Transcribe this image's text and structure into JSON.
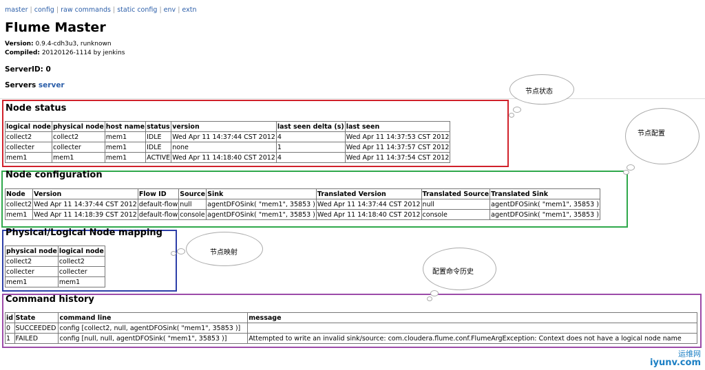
{
  "nav": [
    "master",
    "config",
    "raw commands",
    "static config",
    "env",
    "extn"
  ],
  "title": "Flume Master",
  "version_label": "Version:",
  "version": "0.9.4-cdh3u3, runknown",
  "compiled_label": "Compiled:",
  "compiled": "20120126-1114 by jenkins",
  "serverid_label": "ServerID:",
  "serverid": "0",
  "servers_label": "Servers",
  "servers_link": "server",
  "node_status": {
    "title": "Node status",
    "headers": [
      "logical node",
      "physical node",
      "host name",
      "status",
      "version",
      "last seen delta (s)",
      "last seen"
    ],
    "rows": [
      [
        "collect2",
        "collect2",
        "mem1",
        "IDLE",
        "Wed Apr 11 14:37:44 CST 2012",
        "4",
        "Wed Apr 11 14:37:53 CST 2012"
      ],
      [
        "collecter",
        "collecter",
        "mem1",
        "IDLE",
        "none",
        "1",
        "Wed Apr 11 14:37:57 CST 2012"
      ],
      [
        "mem1",
        "mem1",
        "mem1",
        "ACTIVE",
        "Wed Apr 11 14:18:40 CST 2012",
        "4",
        "Wed Apr 11 14:37:54 CST 2012"
      ]
    ]
  },
  "node_config": {
    "title": "Node configuration",
    "headers": [
      "Node",
      "Version",
      "Flow ID",
      "Source",
      "Sink",
      "Translated Version",
      "Translated Source",
      "Translated Sink"
    ],
    "rows": [
      [
        "collect2",
        "Wed Apr 11 14:37:44 CST 2012",
        "default-flow",
        "null",
        "agentDFOSink( \"mem1\", 35853 )",
        "Wed Apr 11 14:37:44 CST 2012",
        "null",
        "agentDFOSink( \"mem1\", 35853 )"
      ],
      [
        "mem1",
        "Wed Apr 11 14:18:39 CST 2012",
        "default-flow",
        "console",
        "agentDFOSink( \"mem1\", 35853 )",
        "Wed Apr 11 14:18:40 CST 2012",
        "console",
        "agentDFOSink( \"mem1\", 35853 )"
      ]
    ]
  },
  "mapping": {
    "title": "Physical/Logical Node mapping",
    "headers": [
      "physical node",
      "logical node"
    ],
    "rows": [
      [
        "collect2",
        "collect2"
      ],
      [
        "collecter",
        "collecter"
      ],
      [
        "mem1",
        "mem1"
      ]
    ]
  },
  "history": {
    "title": "Command history",
    "headers": [
      "id",
      "State",
      "command line",
      "message"
    ],
    "rows": [
      [
        "0",
        "SUCCEEDED",
        "config [collect2, null, agentDFOSink( \"mem1\", 35853 )]",
        ""
      ],
      [
        "1",
        "FAILED",
        "config [null, null, agentDFOSink( \"mem1\", 35853 )]",
        "Attempted to write an invalid sink/source: com.cloudera.flume.conf.FlumeArgException: Context does not have a logical node name"
      ]
    ]
  },
  "callouts": {
    "status": "节点状态",
    "config": "节点配置",
    "mapping": "节点映射",
    "history": "配置命令历史"
  },
  "watermark": {
    "cn": "运维网",
    "url": "iyunv.com"
  },
  "colors": {
    "status_box": "#d0202a",
    "config_box": "#2ea84a",
    "mapping_box": "#2c3ea8",
    "history_box": "#9b4aa8",
    "link": "#2a5da8"
  }
}
